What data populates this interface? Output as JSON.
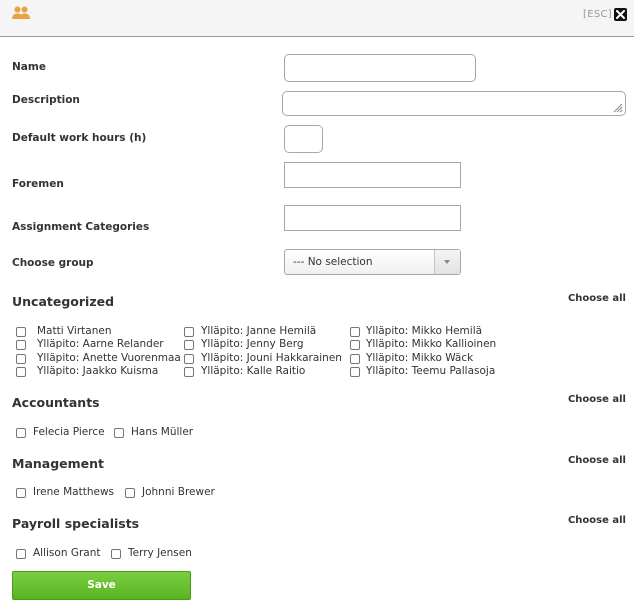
{
  "header": {
    "esc_label": "[ESC]",
    "icon": "group-icon",
    "close_icon": "close-icon",
    "accent_color": "#e8a33c"
  },
  "form": {
    "name_label": "Name",
    "description_label": "Description",
    "work_hours_label": "Default work hours (h)",
    "foremen_label": "Foremen",
    "assignment_categories_label": "Assignment Categories",
    "choose_group_label": "Choose group",
    "choose_group_value": "--- No selection",
    "name_value": "",
    "description_value": "",
    "work_hours_value": "",
    "foremen_value": "",
    "assignment_categories_value": ""
  },
  "groups": {
    "choose_all_label": "Choose all",
    "uncategorized": {
      "title": "Uncategorized",
      "members": [
        "Matti Virtanen",
        "Ylläpito: Aarne Relander",
        "Ylläpito: Anette Vuorenmaa",
        "Ylläpito: Jaakko Kuisma",
        "Ylläpito: Janne Hemilä",
        "Ylläpito: Jenny Berg",
        "Ylläpito: Jouni Hakkarainen",
        "Ylläpito: Kalle Raitio",
        "Ylläpito: Mikko Hemilä",
        "Ylläpito: Mikko Kallioinen",
        "Ylläpito: Mikko Wäck",
        "Ylläpito: Teemu Pallasoja"
      ]
    },
    "accountants": {
      "title": "Accountants",
      "members": [
        "Felecia Pierce",
        "Hans Müller"
      ]
    },
    "management": {
      "title": "Management",
      "members": [
        "Irene Matthews",
        "Johnni Brewer"
      ]
    },
    "payroll": {
      "title": "Payroll specialists",
      "members": [
        "Allison Grant",
        "Terry Jensen"
      ]
    }
  },
  "actions": {
    "save_label": "Save",
    "save_color": "#66bf2e"
  }
}
